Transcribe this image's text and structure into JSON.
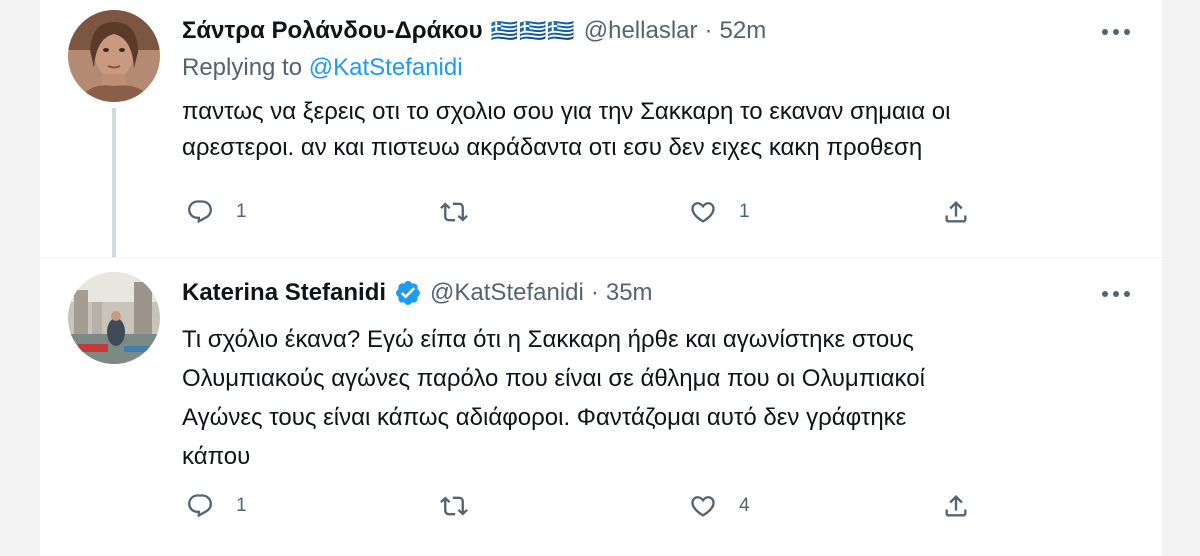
{
  "tweets": [
    {
      "author_name": "Σάντρα Ρολάνδου-Δράκου",
      "flags": "🇬🇷🇬🇷🇬🇷",
      "handle": "@hellaslar",
      "separator": "·",
      "time": "52m",
      "reply_prefix": "Replying to",
      "reply_to": "@KatStefanidi",
      "text_lines": [
        "παντως να ξερεις οτι το σχολιο σου για την Σακκαρη το εκαναν σημαια οι",
        "αρεστεροι. αν και πιστευω ακράδαντα οτι εσυ δεν ειχες  κακη προθεση"
      ],
      "reply_count": "1",
      "retweet_count": "",
      "like_count": "1"
    },
    {
      "author_name": "Katerina Stefanidi",
      "verified": true,
      "handle": "@KatStefanidi",
      "separator": "·",
      "time": "35m",
      "text_lines": [
        "Τι σχόλιο έκανα? Εγώ είπα ότι η Σακκαρη ήρθε και αγωνίστηκε στους",
        "Ολυμπιακούς αγώνες παρόλο που είναι σε άθλημα που οι Ολυμπιακοί",
        "Αγώνες τους είναι κάπως αδιάφοροι. Φαντάζομαι αυτό δεν γράφτηκε",
        "κάπου"
      ],
      "reply_count": "1",
      "retweet_count": "",
      "like_count": "4"
    }
  ],
  "icons": {
    "more": "more-icon",
    "reply": "reply-icon",
    "retweet": "retweet-icon",
    "like": "like-icon",
    "share": "share-icon",
    "verified": "verified-badge-icon"
  },
  "colors": {
    "text": "#0f1419",
    "secondary": "#536471",
    "link": "#1d9bf0",
    "thread_line": "#cfd9de"
  }
}
